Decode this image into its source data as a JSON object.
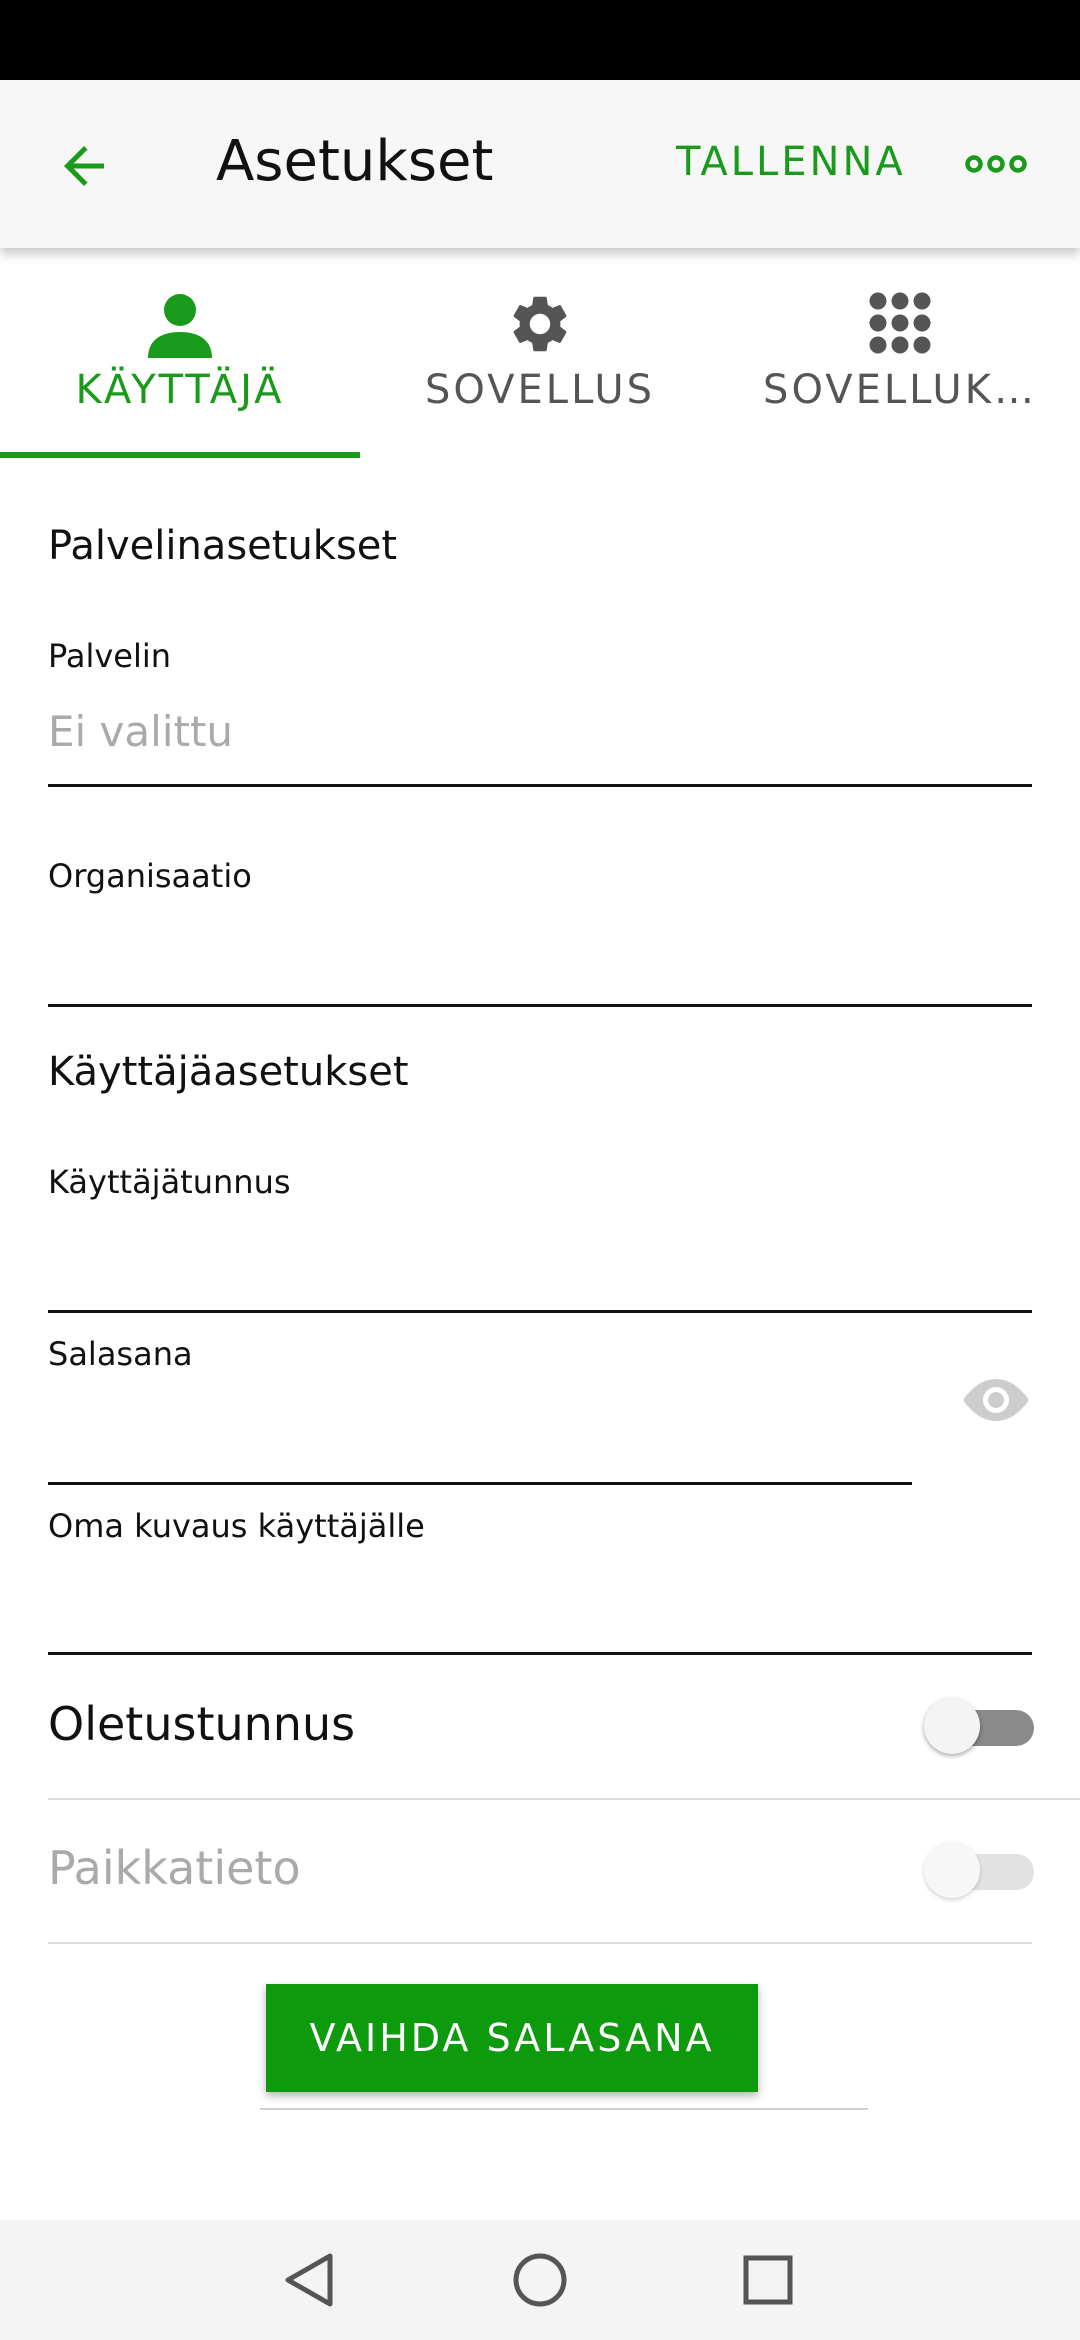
{
  "app_bar": {
    "title": "Asetukset",
    "save_label": "TALLENNA"
  },
  "tabs": [
    {
      "label": "KÄYTTÄJÄ",
      "icon": "person-icon",
      "active": true
    },
    {
      "label": "SOVELLUS",
      "icon": "gear-icon",
      "active": false
    },
    {
      "label": "SOVELLUK…",
      "icon": "apps-grid-icon",
      "active": false
    }
  ],
  "server_section": {
    "title": "Palvelinasetukset",
    "server_label": "Palvelin",
    "server_value": "Ei valittu",
    "organization_label": "Organisaatio",
    "organization_value": ""
  },
  "user_section": {
    "title": "Käyttäjäasetukset",
    "username_label": "Käyttäjätunnus",
    "username_value": "",
    "password_label": "Salasana",
    "password_value": "",
    "description_label": "Oma kuvaus käyttäjälle",
    "description_value": ""
  },
  "toggles": [
    {
      "label": "Oletustunnus",
      "enabled": true,
      "checked": false
    },
    {
      "label": "Paikkatieto",
      "enabled": false,
      "checked": false
    }
  ],
  "change_password_label": "VAIHDA SALASANA",
  "colors": {
    "accent": "#1a9a1a",
    "button": "#0d9a0d",
    "status_bar": "#000000",
    "app_bar": "#f7f7f7"
  }
}
